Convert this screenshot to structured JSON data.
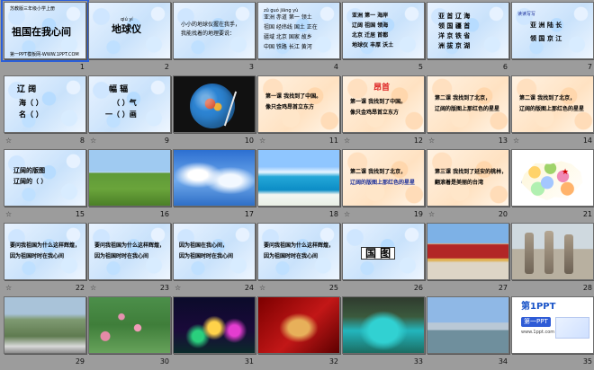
{
  "slides": [
    {
      "number": "1",
      "lines": [
        "祖国在我心间"
      ],
      "footnote": "第一PPT模板网-WWW.1PPT.COM",
      "header": "苏教版三年级小学上册"
    },
    {
      "number": "2",
      "lines": [
        "地球仪"
      ],
      "pinyin": "qiú yí"
    },
    {
      "number": "3",
      "lines": [
        "小小的地球仪握在我手，",
        "拨一拨，转一转，",
        "我能找着的地理要说："
      ]
    },
    {
      "number": "4",
      "lines": [
        "亚洲 赤道 第一 领土",
        "祖国 经纬线 国土 正在",
        "疆域 北京 国家 故乡",
        "中国 铁路 长江 黄河"
      ],
      "pinyin": "zǔ guó jiāng yù"
    },
    {
      "number": "5",
      "lines": [
        "亚洲 第一 海岸",
        "辽阔 祖国 领海",
        "北京 迁居 首都",
        "地球仪 丰厚 沃土"
      ]
    },
    {
      "number": "6",
      "lines": [
        "亚 首 辽 海",
        "领 国 疆 首",
        "洋 京 铁 省",
        "洲 拔 京 湖"
      ]
    },
    {
      "number": "7",
      "lines": [
        "亚 洲 陆 长",
        "领 国 京 江"
      ],
      "headline": "读读写写"
    },
    {
      "number": "8",
      "lines": [
        "辽 阔",
        "海（   ）",
        "名（   ）"
      ]
    },
    {
      "number": "9",
      "lines": [
        "幅 辐",
        "（   ）气",
        "一（   ）画"
      ]
    },
    {
      "number": "10",
      "lines": []
    },
    {
      "number": "11",
      "lines": [
        "第一课 我找到了中国。",
        "像只金鸡昂首立东方"
      ],
      "headline": "中国"
    },
    {
      "number": "12",
      "lines": [
        "第一课 我找到了中国。",
        "像只金鸡昂首立东方"
      ],
      "headline": "昂首"
    },
    {
      "number": "13",
      "lines": [
        "第二课 我找到了北京，",
        "辽阔的版图上那红色的星星"
      ]
    },
    {
      "number": "14",
      "lines": [
        "第二课 我找到了北京，",
        "辽阔的版图上那红色的星星"
      ]
    },
    {
      "number": "15",
      "lines": [
        "辽阔的版图",
        "辽阔的（  ）"
      ]
    },
    {
      "number": "16",
      "lines": []
    },
    {
      "number": "17",
      "lines": []
    },
    {
      "number": "18",
      "lines": []
    },
    {
      "number": "19",
      "lines": [
        "第二课 我找到了北京，",
        "辽阔的版图上那红色的星星"
      ]
    },
    {
      "number": "20",
      "lines": [
        "第三课 我找到了延安的桃林，",
        "翻滚着是美丽的台湾"
      ]
    },
    {
      "number": "21",
      "lines": []
    },
    {
      "number": "22",
      "lines": [
        "要问我祖国为什么这样辉煌，",
        "因为祖国时时在我心间"
      ]
    },
    {
      "number": "23",
      "lines": [
        "要问我祖国为什么这样辉煌，",
        "因为祖国时时在我心间"
      ]
    },
    {
      "number": "24",
      "lines": [
        "因为祖国在我心间，",
        "因为祖国时时在我心间"
      ]
    },
    {
      "number": "25",
      "lines": [
        "要问我祖国为什么这样辉煌，",
        "因为祖国时时在我心间"
      ]
    },
    {
      "number": "26",
      "lines": [
        "国 图"
      ]
    },
    {
      "number": "27",
      "lines": []
    },
    {
      "number": "28",
      "lines": []
    },
    {
      "number": "29",
      "lines": []
    },
    {
      "number": "30",
      "lines": []
    },
    {
      "number": "31",
      "lines": []
    },
    {
      "number": "32",
      "lines": []
    },
    {
      "number": "33",
      "lines": []
    },
    {
      "number": "34",
      "lines": []
    },
    {
      "number": "35",
      "lines": [
        "第1PPT",
        "第一PPT",
        "www.1ppt.com"
      ]
    }
  ],
  "colors": {
    "red": "#d22",
    "blue": "#1b2f9a",
    "select": "#2b5fd9"
  },
  "icons": {
    "slide_transition": "star-icon"
  }
}
